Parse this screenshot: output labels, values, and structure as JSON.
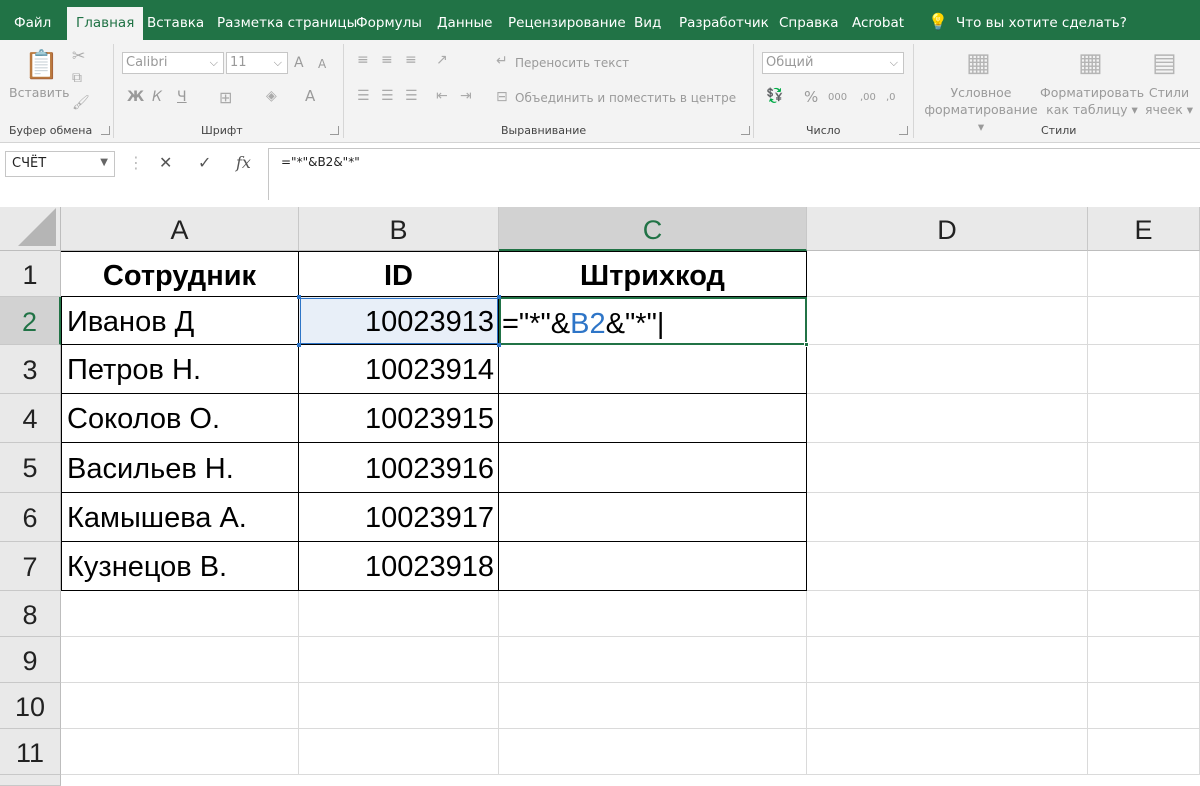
{
  "tabs": [
    "Файл",
    "Главная",
    "Вставка",
    "Разметка страницы",
    "Формулы",
    "Данные",
    "Рецензирование",
    "Вид",
    "Разработчик",
    "Справка",
    "Acrobat"
  ],
  "tell_me": "Что вы хотите сделать?",
  "ribbon": {
    "clipboard": {
      "paste": "Вставить",
      "label": "Буфер обмена"
    },
    "font": {
      "name": "Calibri",
      "size": "11",
      "bold": "Ж",
      "italic": "К",
      "underline": "Ч",
      "grow": "A",
      "shrink": "A",
      "color": "A",
      "label": "Шрифт"
    },
    "alignment": {
      "wrap": "Переносить текст",
      "merge": "Объединить и поместить в центре",
      "label": "Выравнивание"
    },
    "number": {
      "format": "Общий",
      "percent": "%",
      "thousands": "000",
      "inc_decimals": ",00",
      "dec_decimals": ",0",
      "label": "Число"
    },
    "styles": {
      "conditional": [
        "Условное",
        "форматирование"
      ],
      "as_table": [
        "Форматировать",
        "как таблицу"
      ],
      "cell_styles": [
        "Стили",
        "ячеек"
      ],
      "label": "Стили"
    }
  },
  "formula_bar": {
    "name_box": "СЧЁТ",
    "fx": "fx",
    "formula": "=\"*\"&B2&\"*\""
  },
  "columns": [
    "A",
    "B",
    "C",
    "D",
    "E"
  ],
  "rows": [
    "1",
    "2",
    "3",
    "4",
    "5",
    "6",
    "7",
    "8",
    "9",
    "10",
    "11"
  ],
  "table": {
    "headers": [
      "Сотрудник",
      "ID",
      "Штрихкод"
    ],
    "records": [
      {
        "name": "Иванов Д",
        "id": "10023913"
      },
      {
        "name": "Петров Н.",
        "id": "10023914"
      },
      {
        "name": "Соколов О.",
        "id": "10023915"
      },
      {
        "name": "Васильев Н.",
        "id": "10023916"
      },
      {
        "name": "Камышева А.",
        "id": "10023917"
      },
      {
        "name": "Кузнецов В.",
        "id": "10023918"
      }
    ]
  },
  "edit_cell": {
    "part1": "=\"*\"&",
    "ref": "B2",
    "part2": "&\"*\""
  },
  "colors": {
    "brand": "#217346",
    "ref_blue": "#2e75c7",
    "ref_fill": "#e8eff8"
  }
}
